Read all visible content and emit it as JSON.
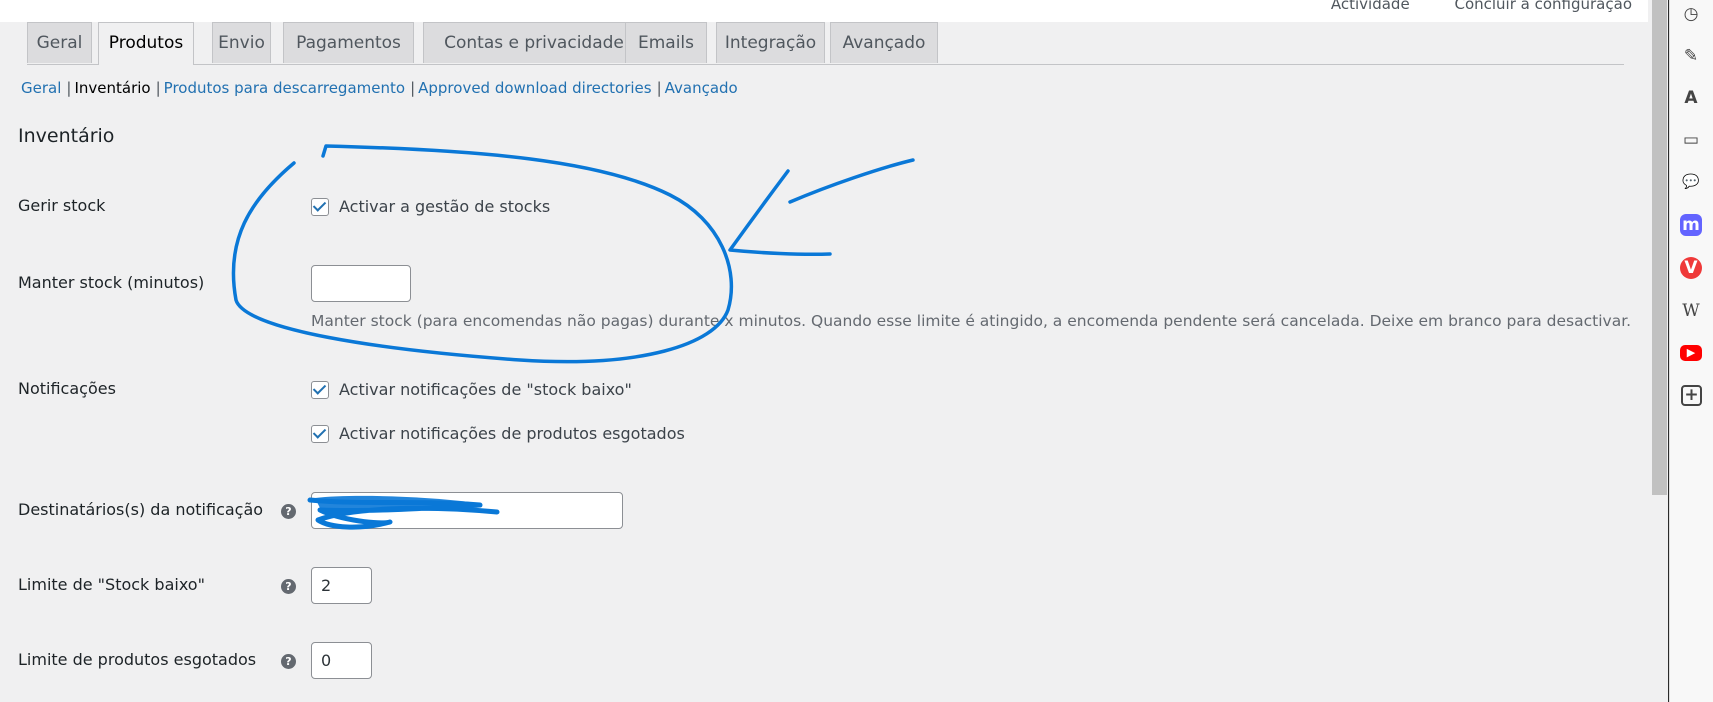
{
  "topbar": {
    "link1": "Actividade",
    "link2": "Concluir a configuração"
  },
  "tabs": [
    {
      "label": "Geral"
    },
    {
      "label": "Produtos"
    },
    {
      "label": "Envio"
    },
    {
      "label": "Pagamentos"
    },
    {
      "label": "Contas e privacidade"
    },
    {
      "label": "Emails"
    },
    {
      "label": "Integração"
    },
    {
      "label": "Avançado"
    }
  ],
  "subnav": {
    "geral": "Geral",
    "inventario": "Inventário",
    "downloads": "Produtos para descarregamento",
    "approved": "Approved download directories",
    "avancado": "Avançado",
    "sep": "|"
  },
  "section": {
    "title": "Inventário"
  },
  "fields": {
    "manage_stock": {
      "label": "Gerir stock",
      "checkbox": "Activar a gestão de stocks"
    },
    "hold_stock": {
      "label": "Manter stock (minutos)",
      "value": "",
      "description": "Manter stock (para encomendas não pagas) durante x minutos. Quando esse limite é atingido, a encomenda pendente será cancelada. Deixe em branco para desactivar."
    },
    "notifications": {
      "label": "Notificações",
      "low_stock": "Activar notificações de \"stock baixo\"",
      "out_of_stock": "Activar notificações de produtos esgotados"
    },
    "recipient": {
      "label": "Destinatários(s) da notificação",
      "value": ""
    },
    "low_stock_threshold": {
      "label": "Limite de \"Stock baixo\"",
      "value": "2"
    },
    "out_of_stock_threshold": {
      "label": "Limite de produtos esgotados",
      "value": "0"
    },
    "help_glyph": "?"
  },
  "sidebar_icons": [
    {
      "name": "clock-icon",
      "glyph": "◷"
    },
    {
      "name": "edit-icon",
      "glyph": "✎"
    },
    {
      "name": "translate-icon",
      "glyph": "A"
    },
    {
      "name": "window-icon",
      "glyph": "▭"
    },
    {
      "name": "chat-icon",
      "glyph": "💬"
    },
    {
      "name": "mastodon-icon",
      "glyph": "m"
    },
    {
      "name": "vivaldi-icon",
      "glyph": "V"
    },
    {
      "name": "wikipedia-icon",
      "glyph": "W"
    },
    {
      "name": "youtube-icon",
      "glyph": "▶"
    },
    {
      "name": "add-panel-icon",
      "glyph": "+"
    }
  ],
  "colors": {
    "accent": "#2271b1",
    "annotation": "#0a78d7"
  }
}
